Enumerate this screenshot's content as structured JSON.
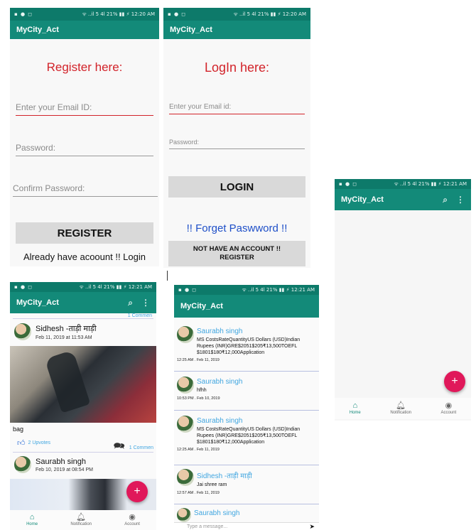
{
  "status": {
    "left": "▪ ● ◻",
    "right_a": "ᯤ ..il 5 4l 21% ▮▮ ⚡ 12:20 AM",
    "right_b": "ᯤ ..il 5 4l 21% ▮▮ ⚡ 12:21 AM"
  },
  "app": {
    "title": "MyCity_Act"
  },
  "register": {
    "heading": "Register here:",
    "email_placeholder": "Enter your Email ID:",
    "password_placeholder": "Password:",
    "confirm_placeholder": "Confirm Password:",
    "register_button": "REGISTER",
    "login_link": "Already have acoount !! Login"
  },
  "login": {
    "heading": "LogIn here:",
    "email_placeholder": "Enter your Email id:",
    "password_placeholder": "Password:",
    "login_button": "LOGIN",
    "forget_link": "!!  Forget Paswword  !!",
    "register_button_line1": "NOT HAVE AN ACCOUNT !!",
    "register_button_line2": "REGISTER"
  },
  "nav": {
    "home": "Home",
    "notification": "Notification",
    "account": "Account"
  },
  "feed": {
    "comments_top": "1 Commen",
    "posts": [
      {
        "name": "Sidhesh -ताड़ी माड़ी",
        "time": "Feb 11, 2019 at 11:53 AM",
        "caption": "bag",
        "upvotes": "2 Upvotes",
        "comments": "1 Commen"
      },
      {
        "name": "Saurabh singh",
        "time": "Feb 10, 2019 at 08:54 PM"
      }
    ]
  },
  "comments": [
    {
      "name": "Saurabh singh",
      "text": "MS CostsRateQuantityUS Dollars (USD)Indian Rupees (INR)GRE$2051$205₹13,500TOEFL $1801$180₹12,000Application",
      "time": "12:25 AM . Feb 11, 2019"
    },
    {
      "name": "Saurabh singh",
      "text": "hfhh",
      "time": "10:53 PM . Feb 10, 2019"
    },
    {
      "name": "Saurabh singh",
      "text": "MS CostsRateQuantityUS Dollars (USD)Indian Rupees (INR)GRE$2051$205₹13,500TOEFL $1801$180₹12,000Application",
      "time": "12:25 AM . Feb 11, 2019"
    },
    {
      "name": "Sidhesh -ताड़ी माड़ी",
      "text": "Jai shree ram",
      "time": "12:57 AM . Feb 11, 2019"
    },
    {
      "name": "Saurabh singh"
    }
  ],
  "composer": {
    "placeholder": "Type a message..."
  },
  "fab": {
    "label": "+"
  }
}
